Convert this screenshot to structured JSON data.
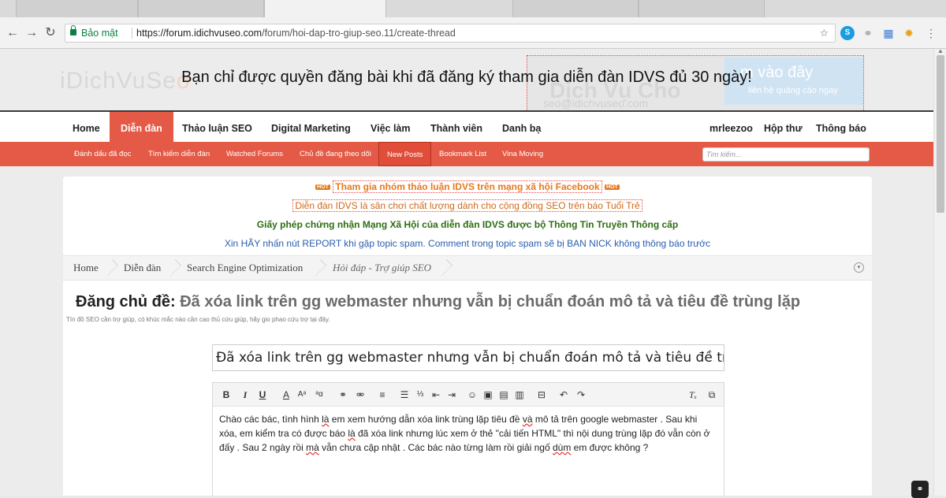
{
  "browser": {
    "secure_label": "Bảo mật",
    "url_host": "https://forum.idichvuseo.com",
    "url_path": "/forum/hoi-dap-tro-giup-seo.11/create-thread"
  },
  "banner": {
    "logo_a": "iDichVuSe",
    "logo_b": "o",
    "ad_text1": "Dịch Vụ Cho",
    "ad_text2": "seo@idichvuseo.com",
    "ad_blue1": "m vào đây",
    "ad_blue2": "liên hệ quảng cáo ngay",
    "notice": "Bạn chỉ được quyền đăng bài khi đã đăng ký tham gia diễn đàn IDVS đủ 30 ngày!"
  },
  "mainnav": {
    "home": "Home",
    "forum": "Diễn đàn",
    "seo": "Thảo luận SEO",
    "marketing": "Digital Marketing",
    "jobs": "Việc làm",
    "members": "Thành viên",
    "directory": "Danh bạ",
    "user": "mrleezoo",
    "inbox": "Hộp thư",
    "alerts": "Thông báo"
  },
  "subnav": {
    "mark_read": "Đánh dấu đã đọc",
    "search_forum": "Tìm kiếm diễn đàn",
    "watched": "Watched Forums",
    "following": "Chủ đề đang theo dõi",
    "new_posts": "New Posts",
    "bookmarks": "Bookmark List",
    "vina": "Vina Moving",
    "search_placeholder": "Tìm kiếm..."
  },
  "announcements": {
    "hot": "HOT",
    "a1": "Tham gia nhóm thảo luận IDVS trên mạng xã hội Facebook",
    "a2": "Diễn đàn IDVS là sân chơi chất lượng dành cho cộng đồng SEO trên báo Tuổi Trẻ",
    "a3": "Giấy phép chứng nhận Mạng Xã Hội của diễn đàn IDVS được bộ Thông Tin Truyền Thông cấp",
    "a4": "Xin HÃY nhấn nút REPORT khi gặp topic spam. Comment trong topic spam sẽ bị BAN NICK không thông báo trước"
  },
  "breadcrumb": [
    "Home",
    "Diễn đàn",
    "Search Engine Optimization",
    "Hỏi đáp - Trợ giúp SEO"
  ],
  "thread": {
    "heading_prefix": "Đăng chủ đề:",
    "heading_title": "Đã xóa link trên gg webmaster nhưng vẫn bị chuẩn đoán mô tả và tiêu đề trùng lặp",
    "forum_desc": "Tín đồ SEO cần trợ giúp, có khúc mắc nào cần cao thủ cứu giúp, hãy gio phao cứu trợ tại đây.",
    "title_value": "Đã xóa link trên gg webmaster nhưng vẫn bị chuẩn đoán mô tả và tiêu đề tr",
    "body_1": "Chào các bác, tình hình ",
    "body_2": "là",
    "body_3": " em xem hướng dẫn xóa link trùng lặp tiêu đề ",
    "body_4": "và",
    "body_5": " mô tả trên google webmaster . Sau khi xóa, em kiểm tra có được báo ",
    "body_6": "là",
    "body_7": " đã xóa link nhưng lúc xem ở thẻ \"cải tiến HTML\" thì nội dung trùng lặp đó vẫn còn ở đấy . Sau 2 ngày rồi ",
    "body_8": "mà",
    "body_9": " vẫn chưa cập nhật . Các bác nào từng làm rồi giải ngố ",
    "body_10": "dùm",
    "body_11": " em được không ?"
  },
  "toolbar_icons": [
    "bold-icon",
    "italic-icon",
    "underline-icon",
    "text-color-icon",
    "font-size-icon",
    "font-family-icon",
    "link-icon",
    "unlink-icon",
    "align-icon",
    "bullet-list-icon",
    "numbered-list-icon",
    "outdent-icon",
    "indent-icon",
    "smilie-icon",
    "image-icon",
    "media-icon",
    "quote-icon",
    "save-draft-icon",
    "undo-icon",
    "redo-icon",
    "remove-format-icon",
    "bbcode-toggle-icon"
  ]
}
